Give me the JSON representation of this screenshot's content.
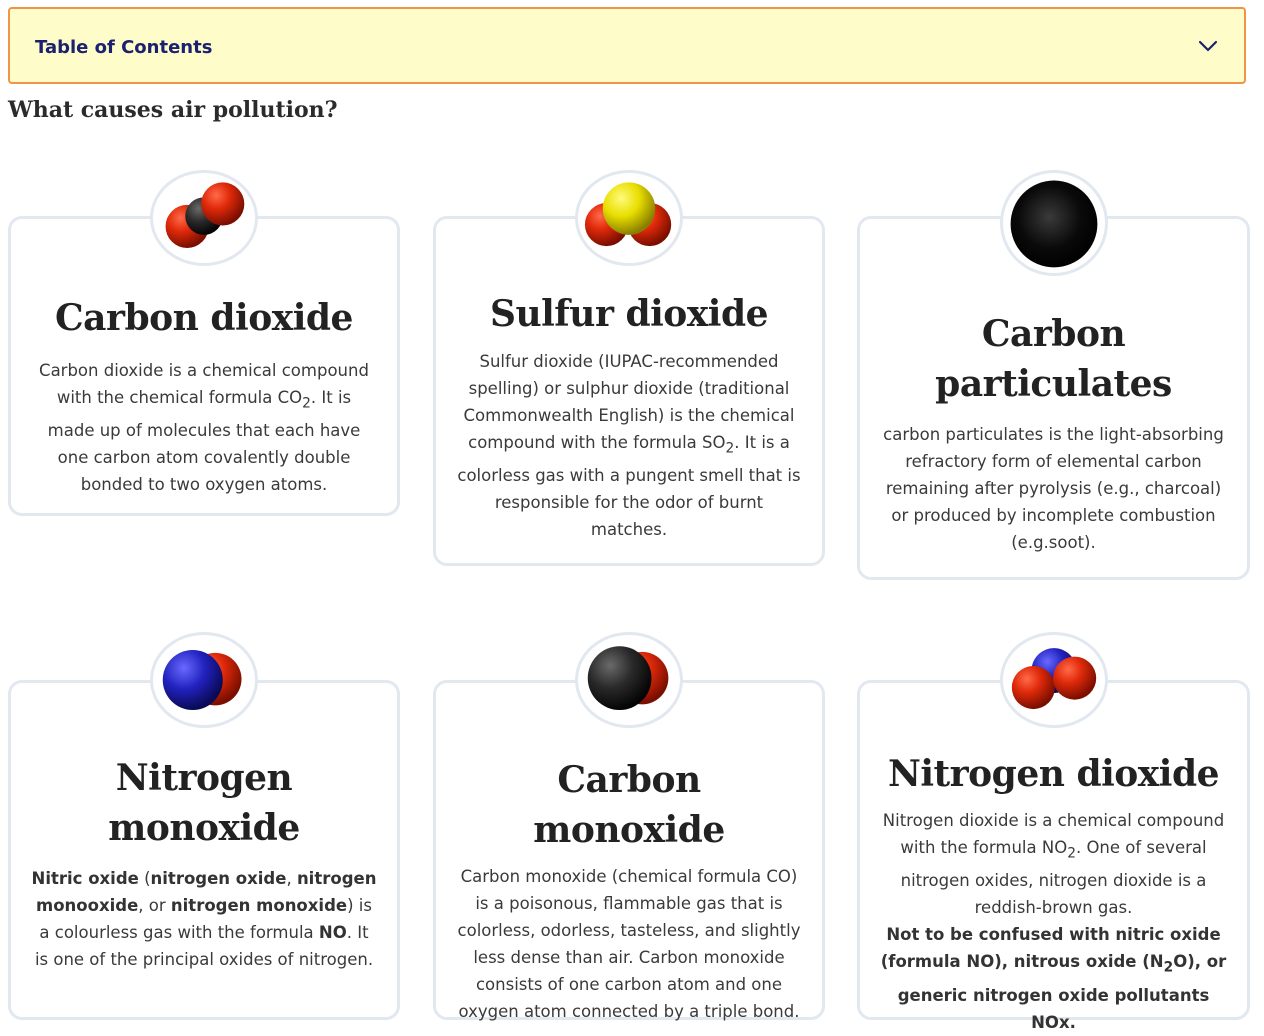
{
  "toc": {
    "title": "Table of Contents",
    "toggle_icon": "chevron-down-icon"
  },
  "section": {
    "heading": "What causes air pollution?"
  },
  "colors": {
    "toc_bg": "#fefcc8",
    "toc_border": "#f09447",
    "toc_text": "#1b2170",
    "card_border": "#e2e8f0"
  },
  "cards": [
    {
      "icon": "co2-molecule-icon",
      "title": "Carbon dioxide",
      "desc_a": "Carbon dioxide is a chemical compound with the chemical formula CO",
      "desc_sub": "2",
      "desc_b": ". It is made up of molecules that each have one carbon atom covalently double bonded to two oxygen atoms."
    },
    {
      "icon": "so2-molecule-icon",
      "title": "Sulfur dioxide",
      "desc_a": "Sulfur dioxide (IUPAC-recommended spelling) or sulphur dioxide (traditional Commonwealth English) is the chemical compound with the formula SO",
      "desc_sub": "2",
      "desc_b": ". It is a colorless gas with a pungent smell that is responsible for the odor of burnt matches."
    },
    {
      "icon": "carbon-particle-icon",
      "title_line1": "Carbon",
      "title_line2": "particulates",
      "desc": "carbon particulates is the light-absorbing refractory form of elemental carbon remaining after pyrolysis (e.g., charcoal) or produced by incomplete combustion (e.g.soot)."
    },
    {
      "icon": "no-molecule-icon",
      "title_line1": "Nitrogen",
      "title_line2": "monoxide",
      "b1": "Nitric oxide",
      "t1": " (",
      "b2": "nitrogen oxide",
      "t2": ", ",
      "b3": "nitrogen monooxide",
      "t3": ", or ",
      "b4": "nitrogen monoxide",
      "t4": ") is a colourless gas with the formula ",
      "b5": "NO",
      "t5": ". It is one of the principal oxides of nitrogen."
    },
    {
      "icon": "co-molecule-icon",
      "title": "Carbon monoxide",
      "desc": "Carbon monoxide (chemical formula CO) is a poisonous, flammable gas that is colorless, odorless, tasteless, and slightly less dense than air. Carbon monoxide consists of one carbon atom and one oxygen atom connected by a triple bond."
    },
    {
      "icon": "no2-molecule-icon",
      "title": "Nitrogen dioxide",
      "desc_a": "Nitrogen dioxide is a chemical compound with the formula NO",
      "desc_sub": "2",
      "desc_b": ". One of several nitrogen oxides, nitrogen dioxide is a reddish-brown gas.",
      "note_a": "Not to be confused with nitric oxide (formula NO), nitrous oxide (N",
      "note_sub": "2",
      "note_b": "O), or generic nitrogen oxide pollutants NOx."
    }
  ]
}
